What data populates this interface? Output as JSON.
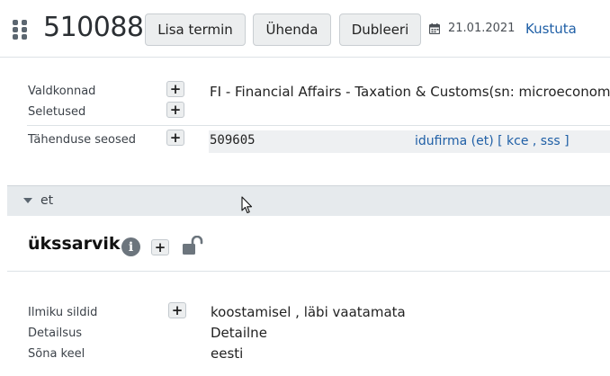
{
  "header": {
    "term_id": "510088",
    "buttons": {
      "add_term": "Lisa termin",
      "merge": "Ühenda",
      "duplicate": "Dubleeri"
    },
    "date": "21.01.2021",
    "delete_label": "Kustuta"
  },
  "meaning": {
    "domains_label": "Valdkonnad",
    "domain_value": "FI - Financial Affairs - Taxation & Customs(sn: microeconom",
    "definitions_label": "Seletused",
    "relations_label": "Tähenduse seosed",
    "relation_id": "509605",
    "relation_link": "idufirma (et) [ kce , sss ]"
  },
  "language": {
    "code": "et",
    "word": "ükssarvik",
    "tags_label": "Ilmiku sildid",
    "tags_value": "koostamisel , läbi vaatamata",
    "detail_label": "Detailsus",
    "detail_value": "Detailne",
    "word_lang_label": "Sõna keel",
    "word_lang_value": "eesti"
  },
  "icons": [
    "drag-handle-icon",
    "calendar-icon",
    "plus-icon",
    "caret-down-icon",
    "info-icon",
    "unlock-icon",
    "mouse-cursor-icon"
  ],
  "colors": {
    "link": "#1f5fa6",
    "button_bg": "#eceeef",
    "section_bg": "#e6eaed",
    "relation_bg": "#eef0f2"
  }
}
